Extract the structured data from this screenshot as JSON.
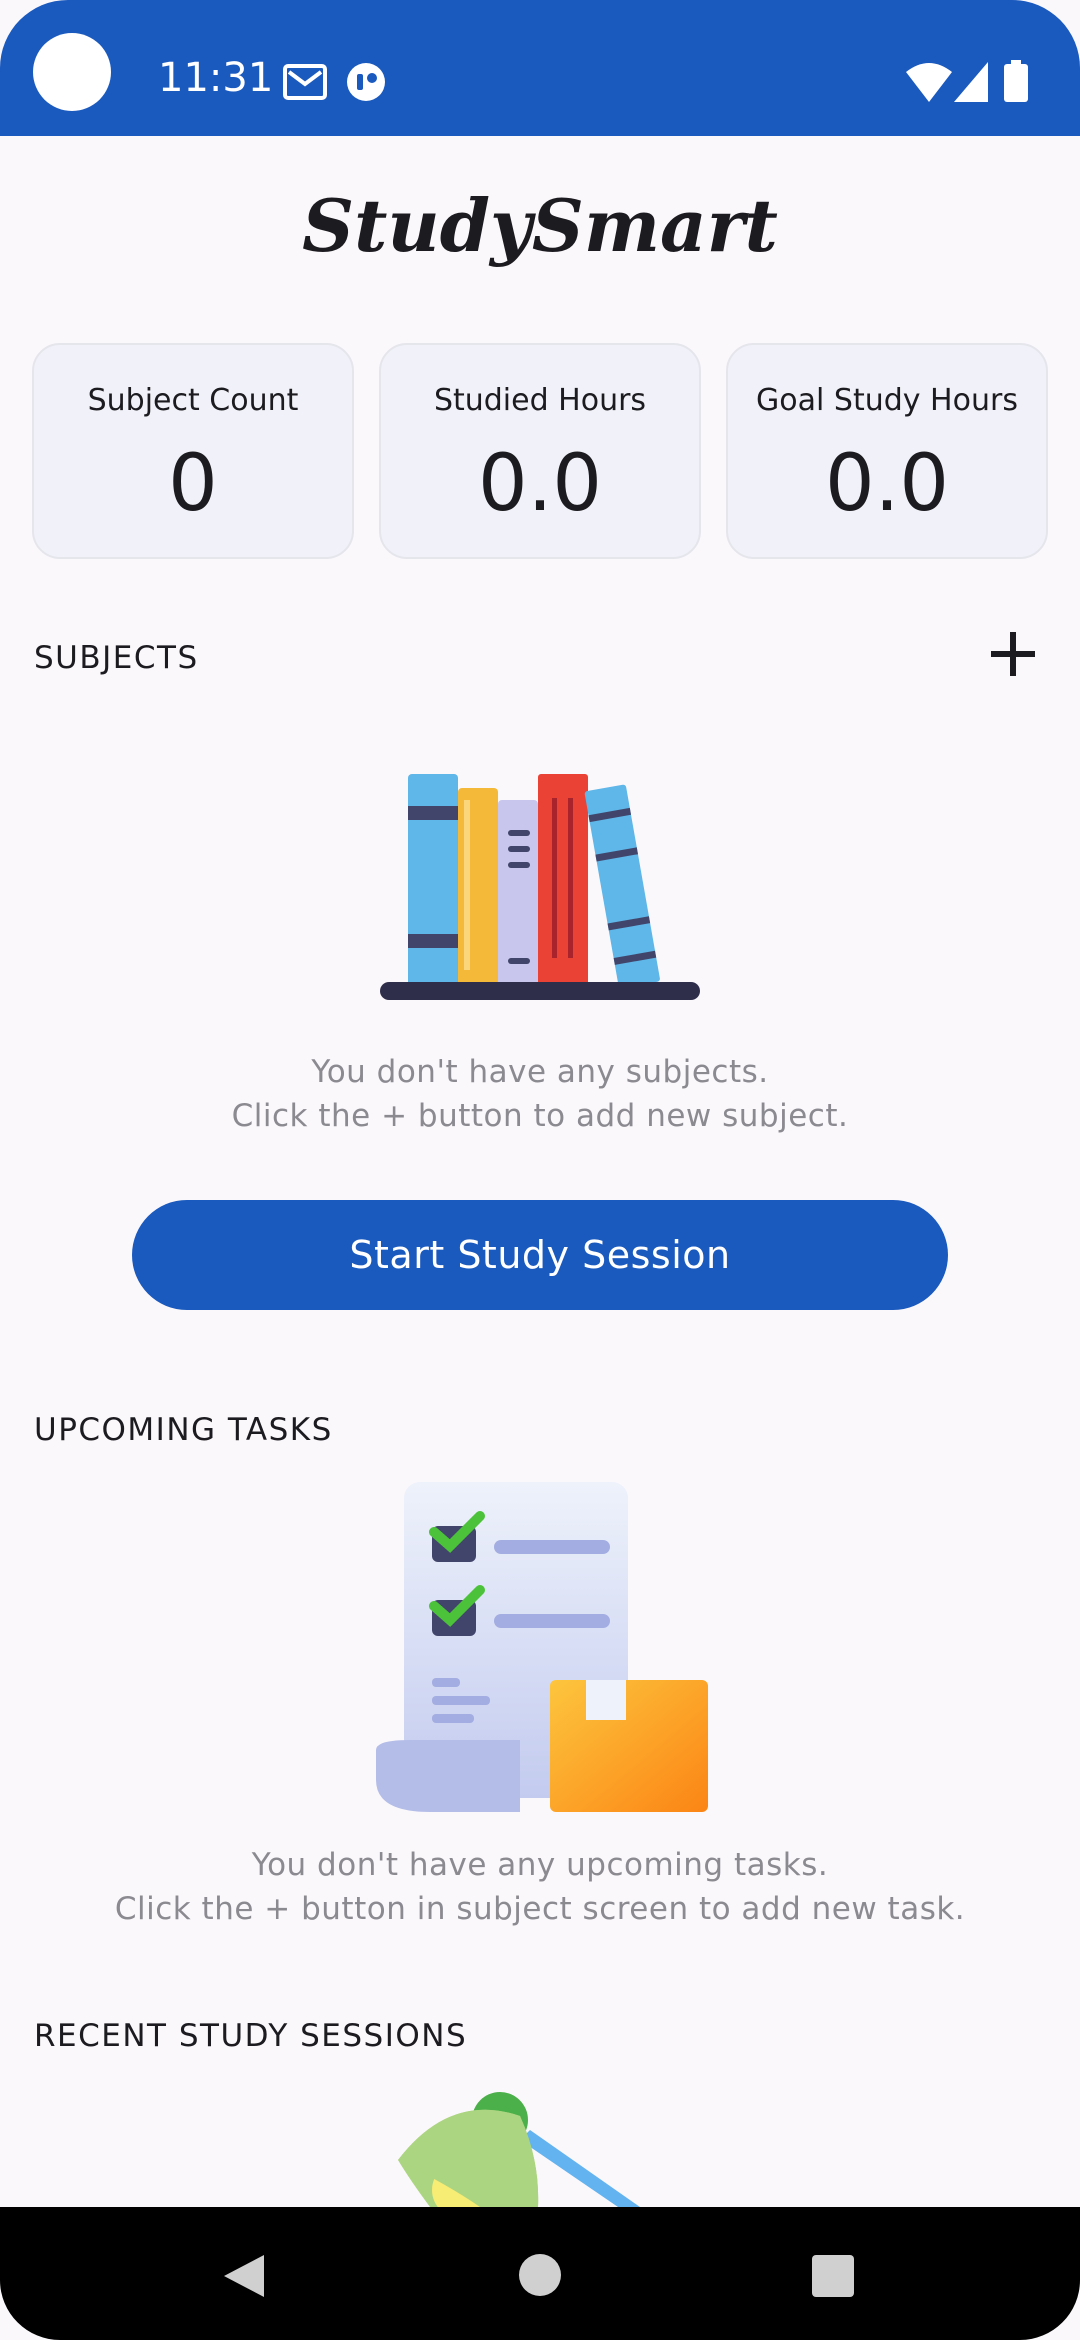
{
  "status_bar": {
    "time": "11:31",
    "icons": [
      "camera-cutout",
      "gmail-icon",
      "notification-app-icon",
      "wifi-icon",
      "signal-icon",
      "battery-icon"
    ]
  },
  "app": {
    "title": "StudySmart"
  },
  "stats": [
    {
      "label": "Subject Count",
      "value": "0"
    },
    {
      "label": "Studied Hours",
      "value": "0.0"
    },
    {
      "label": "Goal Study Hours",
      "value": "0.0"
    }
  ],
  "subjects": {
    "header": "SUBJECTS",
    "add_icon": "plus-icon",
    "empty_line1": "You don't have any subjects.",
    "empty_line2": "Click the + button to add new subject."
  },
  "actions": {
    "start_session": "Start Study Session"
  },
  "tasks": {
    "header": "UPCOMING TASKS",
    "empty_line1": "You don't have any upcoming tasks.",
    "empty_line2": "Click the + button in subject screen to add new task."
  },
  "sessions": {
    "header": "RECENT STUDY SESSIONS"
  },
  "colors": {
    "primary": "#1a59be",
    "background": "#fbf8fc",
    "card": "#f1f2f9",
    "muted_text": "#8b8a90"
  }
}
